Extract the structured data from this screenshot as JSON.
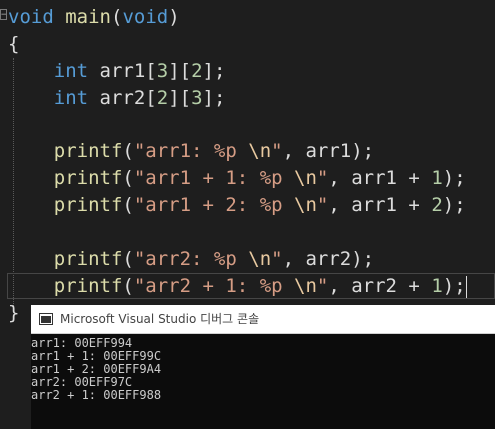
{
  "editor": {
    "fold_glyph": "−",
    "lines": {
      "l1": {
        "kw": "void",
        "fn": "main",
        "open": "(",
        "kw2": "void",
        "close": ")"
      },
      "l2": {
        "brace": "{"
      },
      "l3": {
        "kw": "int",
        "rest": " arr1[",
        "n1": "3",
        "m": "][",
        "n2": "2",
        "end": "];"
      },
      "l4": {
        "kw": "int",
        "rest": " arr2[",
        "n1": "2",
        "m": "][",
        "n2": "3",
        "end": "];"
      },
      "l6": {
        "fn": "printf",
        "open": "(",
        "str": "\"arr1: %p ",
        "esc": "\\n",
        "strend": "\"",
        "args": ", arr1);"
      },
      "l7": {
        "fn": "printf",
        "open": "(",
        "str": "\"arr1 + 1: %p ",
        "esc": "\\n",
        "strend": "\"",
        "args": ", arr1 + ",
        "num": "1",
        "end": ");"
      },
      "l8": {
        "fn": "printf",
        "open": "(",
        "str": "\"arr1 + 2: %p ",
        "esc": "\\n",
        "strend": "\"",
        "args": ", arr1 + ",
        "num": "2",
        "end": ");"
      },
      "l10": {
        "fn": "printf",
        "open": "(",
        "str": "\"arr2: %p ",
        "esc": "\\n",
        "strend": "\"",
        "args": ", arr2);"
      },
      "l11": {
        "fn": "printf",
        "open": "(",
        "str": "\"arr2 + 1: %p ",
        "esc": "\\n",
        "strend": "\"",
        "args": ", arr2 + ",
        "num": "1",
        "end": ");"
      },
      "l12": {
        "brace": "}"
      }
    }
  },
  "console": {
    "icon": "console-window-icon",
    "title": "Microsoft Visual Studio 디버그 콘솔",
    "output": [
      "arr1: 00EFF994",
      "arr1 + 1: 00EFF99C",
      "arr1 + 2: 00EFF9A4",
      "arr2: 00EFF97C",
      "arr2 + 1: 00EFF988"
    ]
  },
  "colors": {
    "background": "#1e1e1e",
    "keyword": "#569cd6",
    "function": "#dcdcaa",
    "string": "#d69d85",
    "number": "#b5cea8",
    "console_bg": "#0c0c0c"
  }
}
